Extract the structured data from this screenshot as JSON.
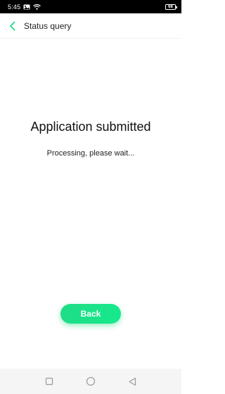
{
  "status_bar": {
    "time": "5:45",
    "battery": "68",
    "icons": [
      "image-notification-icon",
      "wifi-icon"
    ]
  },
  "header": {
    "title": "Status query",
    "back_icon": "chevron-left-icon"
  },
  "main": {
    "title": "Application submitted",
    "subtitle": "Processing, please wait...",
    "back_button_label": "Back"
  },
  "nav_bar": {
    "icons": [
      "recent-apps-square-icon",
      "home-circle-icon",
      "back-triangle-icon"
    ]
  },
  "colors": {
    "accent": "#1fdc86",
    "status_bar_bg": "#000000",
    "nav_bar_bg": "#f5f5f5"
  }
}
